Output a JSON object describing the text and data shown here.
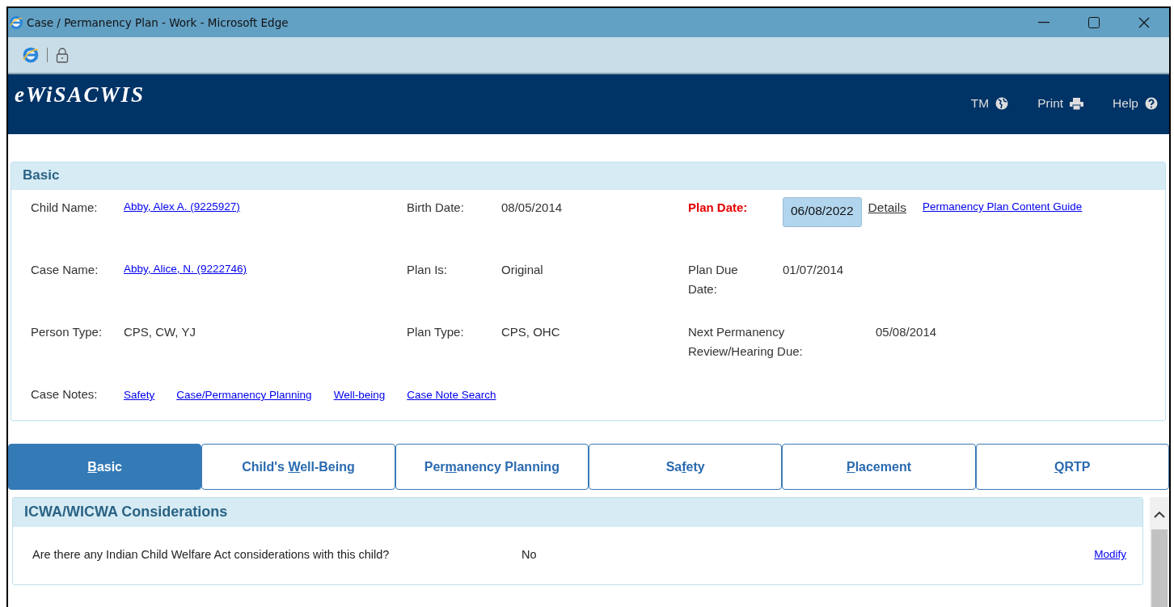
{
  "window": {
    "title": "Case / Permanency Plan - Work - Microsoft Edge"
  },
  "header": {
    "logo": "eWiSACWIS",
    "actions": [
      {
        "label": "TM"
      },
      {
        "label": "Print"
      },
      {
        "label": "Help"
      }
    ]
  },
  "basic": {
    "title": "Basic",
    "rows": [
      [
        {
          "kind": "link",
          "label": "Child Name:",
          "value": "Abby, Alex A.  (9225927)"
        },
        {
          "kind": "text",
          "label": "Birth Date:",
          "value": "08/05/2014"
        },
        {
          "kind": "date_entry",
          "label": "Plan Date:",
          "required": true,
          "value": "06/08/2022",
          "links": [
            {
              "kind": "plain",
              "text": "Details"
            },
            {
              "kind": "link",
              "text": "Permanency Plan Content Guide"
            }
          ]
        }
      ],
      [
        {
          "kind": "link",
          "label": "Case Name:",
          "value": "Abby, Alice, N.  (9222746)"
        },
        {
          "kind": "text",
          "label": "Plan Is:",
          "value": "Original"
        },
        {
          "kind": "text",
          "label": "Plan Due Date:",
          "value": "01/07/2014"
        }
      ],
      [
        {
          "kind": "text",
          "label": "Person Type:",
          "value": "CPS, CW, YJ"
        },
        {
          "kind": "text",
          "label": "Plan Type:",
          "value": "CPS, OHC"
        },
        {
          "kind": "wide",
          "label": "Next Permanency Review/Hearing Due:",
          "value": "05/08/2014"
        }
      ]
    ],
    "case_notes": {
      "label": "Case Notes:",
      "links": [
        "Safety",
        "Case/Permanency Planning",
        "Well-being",
        "Case Note Search"
      ]
    }
  },
  "tabs": [
    {
      "key": "B",
      "after": "asic",
      "selected": true
    },
    {
      "before": "Child's ",
      "key": "W",
      "after": "ell-Being",
      "selected": false
    },
    {
      "before": "Per",
      "key": "m",
      "after": "anency Planning",
      "selected": false
    },
    {
      "before": "Sa",
      "key": "f",
      "after": "ety",
      "selected": false
    },
    {
      "key": "P",
      "after": "lacement",
      "selected": false
    },
    {
      "key": "Q",
      "after": "RTP",
      "selected": false
    }
  ],
  "icwa": {
    "title": "ICWA/WICWA Considerations",
    "question": "Are there any Indian Child Welfare Act considerations with this child?",
    "answer": "No",
    "action": "Modify"
  }
}
